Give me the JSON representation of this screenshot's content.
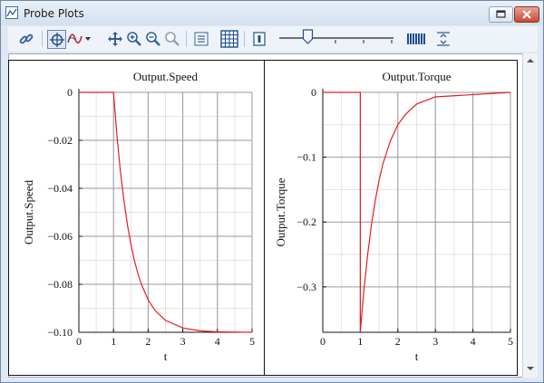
{
  "window": {
    "title": "Probe Plots",
    "accent": "#c62828"
  },
  "toolbar": {
    "buttons": [
      {
        "name": "link-icon"
      },
      {
        "name": "crosshair-icon"
      },
      {
        "name": "curve-select-icon"
      },
      {
        "name": "pan-icon"
      },
      {
        "name": "zoom-in-icon"
      },
      {
        "name": "zoom-out-icon"
      },
      {
        "name": "zoom-fit-icon"
      },
      {
        "name": "list-icon"
      },
      {
        "name": "grid-icon"
      },
      {
        "name": "single-plot-icon"
      },
      {
        "name": "barcode-icon"
      },
      {
        "name": "fit-height-icon"
      }
    ],
    "slider_value": 0.25
  },
  "chart_data": [
    {
      "type": "line",
      "title": "Output.Speed",
      "xlabel": "t",
      "ylabel": "Output.Speed",
      "xlim": [
        0,
        5
      ],
      "ylim": [
        -0.1,
        0
      ],
      "x_ticks": [
        "0",
        "1",
        "2",
        "3",
        "4",
        "5"
      ],
      "y_ticks": [
        "0",
        "−0.02",
        "−0.04",
        "−0.06",
        "−0.08",
        "−0.10"
      ],
      "grid": true,
      "series": [
        {
          "color": "#e0201e",
          "x": [
            0,
            1,
            1.1,
            1.2,
            1.3,
            1.4,
            1.5,
            1.6,
            1.7,
            1.8,
            2.0,
            2.2,
            2.5,
            3.0,
            3.5,
            4.0,
            5.0
          ],
          "y": [
            0,
            0,
            -0.0181,
            -0.033,
            -0.0451,
            -0.0551,
            -0.0632,
            -0.0699,
            -0.0753,
            -0.0798,
            -0.0865,
            -0.0909,
            -0.095,
            -0.0982,
            -0.0994,
            -0.0998,
            -0.1
          ]
        }
      ]
    },
    {
      "type": "line",
      "title": "Output.Torque",
      "xlabel": "t",
      "ylabel": "Output.Torque",
      "xlim": [
        0,
        5
      ],
      "ylim": [
        -0.37,
        0
      ],
      "x_ticks": [
        "0",
        "1",
        "2",
        "3",
        "4",
        "5"
      ],
      "y_ticks": [
        "0",
        "−0.1",
        "−0.2",
        "−0.3"
      ],
      "grid": true,
      "series": [
        {
          "color": "#e0201e",
          "x": [
            0,
            1,
            1.0,
            1.05,
            1.1,
            1.2,
            1.3,
            1.4,
            1.5,
            1.6,
            1.8,
            2.0,
            2.2,
            2.5,
            3.0,
            5.0
          ],
          "y": [
            0,
            0,
            -0.37,
            -0.335,
            -0.303,
            -0.248,
            -0.203,
            -0.166,
            -0.136,
            -0.111,
            -0.075,
            -0.05,
            -0.034,
            -0.018,
            -0.007,
            0
          ]
        }
      ]
    }
  ]
}
